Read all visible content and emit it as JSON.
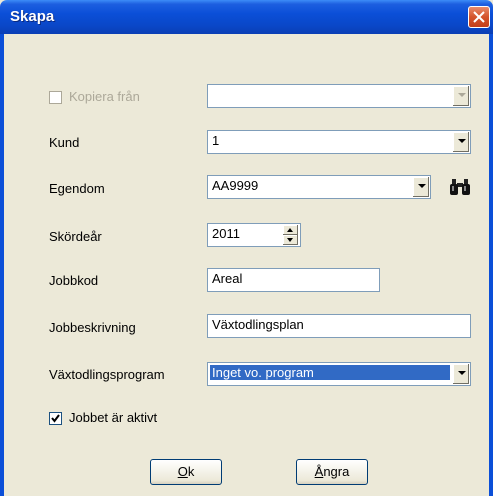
{
  "window": {
    "title": "Skapa"
  },
  "form": {
    "copy_from": {
      "label": "Kopiera från",
      "checked": false,
      "enabled": false,
      "value": ""
    },
    "kund": {
      "label": "Kund",
      "value": "1"
    },
    "egendom": {
      "label": "Egendom",
      "value": "AA9999",
      "search_icon": "binoculars-icon"
    },
    "skordear": {
      "label": "Skördeår",
      "value": "2011"
    },
    "jobbkod": {
      "label": "Jobbkod",
      "value": "Areal"
    },
    "jobbeskrivning": {
      "label": "Jobbeskrivning",
      "value": "Växtodlingsplan"
    },
    "vaxtodlingsprogram": {
      "label": "Växtodlingsprogram",
      "value": "Inget vo. program"
    },
    "active": {
      "label": "Jobbet är aktivt",
      "checked": true
    }
  },
  "buttons": {
    "ok": {
      "mnemonic": "O",
      "rest": "k"
    },
    "cancel": {
      "mnemonic": "Å",
      "rest": "ngra"
    }
  },
  "colors": {
    "titlebar": "#0b4fd8",
    "selection": "#316ac5",
    "dialog_bg": "#ece9d8"
  }
}
